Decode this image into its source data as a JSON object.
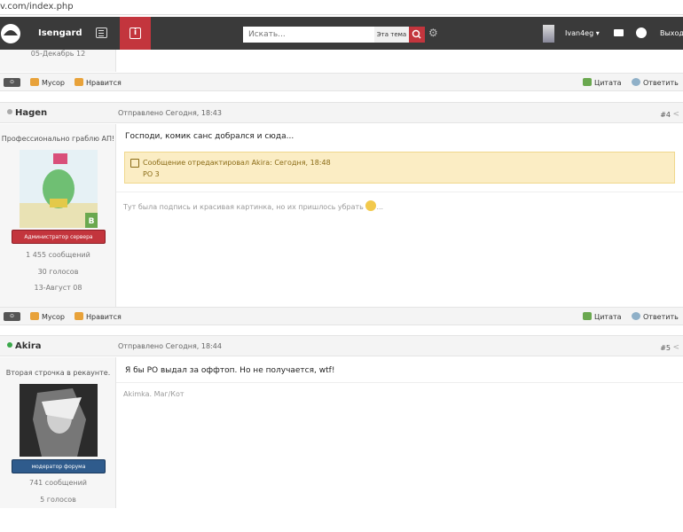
{
  "browser": {
    "url_fragment": "v.com/index.php"
  },
  "nav": {
    "site_name": "Isengard",
    "search_placeholder": "Искать...",
    "search_scope": "Эта тема",
    "username": "Ivan4eg",
    "logout": "Выход"
  },
  "prev_post": {
    "date": "05-Декабрь 12"
  },
  "actions": {
    "trash": "Мусор",
    "like": "Нравится",
    "quote": "Цитата",
    "reply": "Ответить"
  },
  "posts": [
    {
      "author": "Hagen",
      "online": false,
      "date": "Отправлено Сегодня, 18:43",
      "number": "#4",
      "title": "Профессионально граблю АП!",
      "rank": "Администратор сервера",
      "stats": [
        "1 455 сообщений",
        "30 голосов",
        "13-Август 08"
      ],
      "message": "Господи, комик санс добрался и сюда...",
      "edit_line": "Сообщение отредактировал Akira: Сегодня, 18:48",
      "edit_reason": "РО 3",
      "signature": "Тут была подпись и красивая картинка, но их пришлось убрать",
      "badge_letter": "B"
    },
    {
      "author": "Akira",
      "online": true,
      "date": "Отправлено Сегодня, 18:44",
      "number": "#5",
      "title": "Вторая строчка в рекаунте.",
      "rank": "модератор форума",
      "stats": [
        "741 сообщений",
        "5 голосов"
      ],
      "message": "Я бы РО выдал за оффтоп. Но не получается, wtf!",
      "signature": "Akimka. Маг/Кот"
    }
  ],
  "colors": {
    "nav_bg": "#3a3a3a",
    "accent": "#c3353d",
    "edit_bg": "#fbedc4"
  }
}
